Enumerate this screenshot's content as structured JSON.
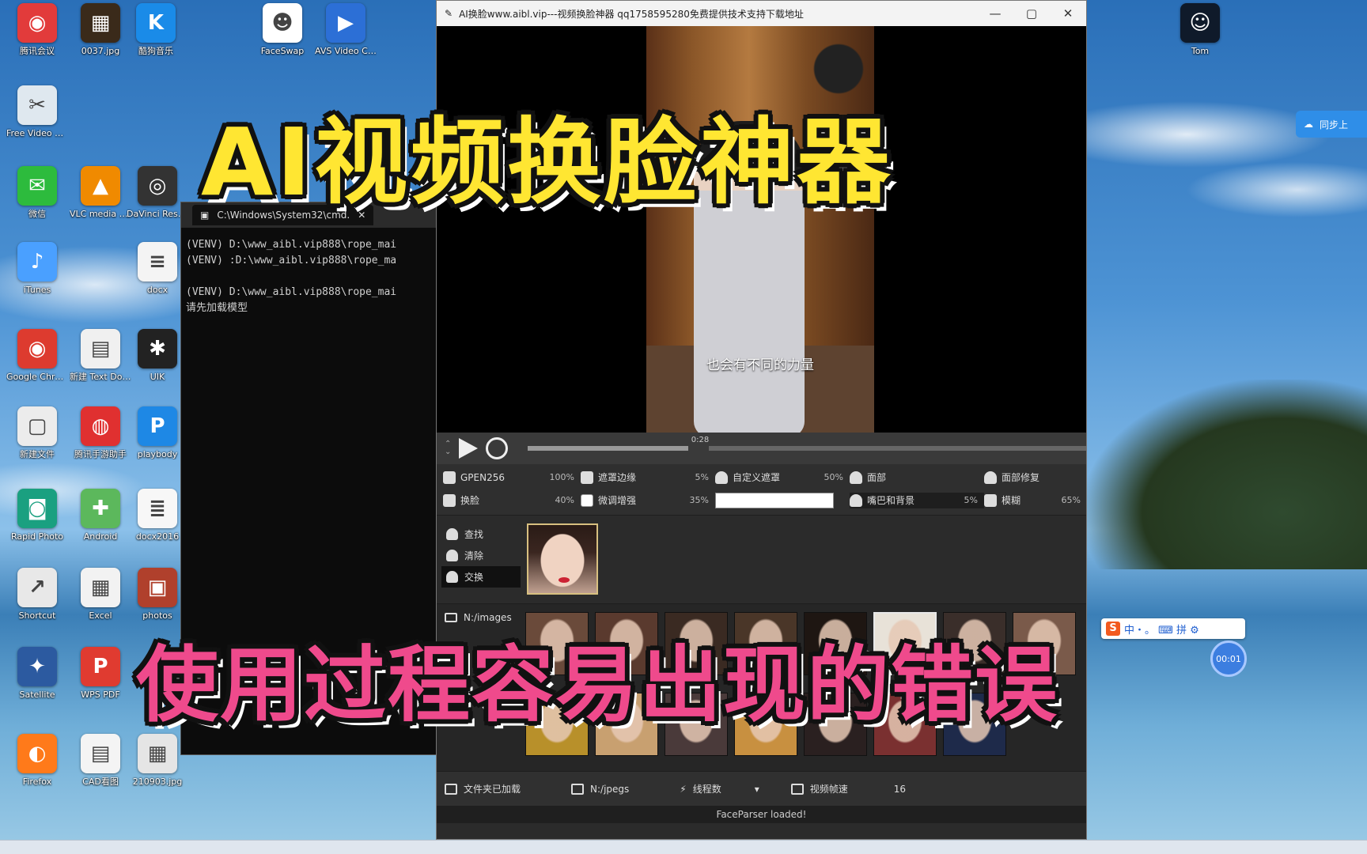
{
  "overlay": {
    "title": "AI视频换脸神器",
    "subtitle": "使用过程容易出现的错误"
  },
  "desktop_icons": [
    {
      "label": "腾讯会议",
      "icon": "meeting-icon",
      "color": "#e23b3b",
      "glyph": "◉"
    },
    {
      "label": "0037.jpg",
      "icon": "image-file-icon",
      "color": "#3a2a1a",
      "glyph": "▦"
    },
    {
      "label": "酷狗音乐",
      "icon": "music-app-icon",
      "color": "#1a8be8",
      "glyph": "K"
    },
    {
      "label": "FaceSwap",
      "icon": "faceswap-app-icon",
      "color": "#ffffff",
      "glyph": "☻"
    },
    {
      "label": "AVS Video Converter",
      "icon": "video-converter-icon",
      "color": "#2c6fd6",
      "glyph": "▶"
    },
    {
      "label": "Free Video Cutter Joi...",
      "icon": "video-cutter-icon",
      "color": "#dfe8ef",
      "glyph": "✂"
    },
    {
      "label": "微信",
      "icon": "wechat-icon",
      "color": "#2dbb3d",
      "glyph": "✉"
    },
    {
      "label": "VLC media player",
      "icon": "vlc-icon",
      "color": "#f08a00",
      "glyph": "▲"
    },
    {
      "label": "DaVinci Resolve",
      "icon": "davinci-icon",
      "color": "#333333",
      "glyph": "◎"
    },
    {
      "label": "iTunes",
      "icon": "itunes-icon",
      "color": "#4aa0ff",
      "glyph": "♪"
    },
    {
      "label": "docx",
      "icon": "document-icon",
      "color": "#f4f4f4",
      "glyph": "≡"
    },
    {
      "label": "Google Chrome",
      "icon": "chrome-icon",
      "color": "#dd3b2f",
      "glyph": "◉"
    },
    {
      "label": "新建 Text Document...",
      "icon": "text-file-icon",
      "color": "#f0f0f0",
      "glyph": "▤"
    },
    {
      "label": "UIK",
      "icon": "uik-app-icon",
      "color": "#222222",
      "glyph": "✱"
    },
    {
      "label": "新建文件",
      "icon": "blank-file-icon",
      "color": "#ececec",
      "glyph": "▢"
    },
    {
      "label": "腾讯手游助手",
      "icon": "game-assistant-icon",
      "color": "#e03030",
      "glyph": "◍"
    },
    {
      "label": "playbody",
      "icon": "playbody-icon",
      "color": "#1e88e5",
      "glyph": "P"
    },
    {
      "label": "Rapid Photo",
      "icon": "photo-app-icon",
      "color": "#1aa080",
      "glyph": "◙"
    },
    {
      "label": "Android",
      "icon": "android-icon",
      "color": "#5cb85c",
      "glyph": "✚"
    },
    {
      "label": "docx2016",
      "icon": "doc-thumb-icon",
      "color": "#f7f7f7",
      "glyph": "≣"
    },
    {
      "label": "Shortcut",
      "icon": "shortcut-icon",
      "color": "#e8e8e8",
      "glyph": "↗"
    },
    {
      "label": "Excel",
      "icon": "spreadsheet-icon",
      "color": "#f2f2f2",
      "glyph": "▦"
    },
    {
      "label": "photos",
      "icon": "photos-icon",
      "color": "#b0402c",
      "glyph": "▣"
    },
    {
      "label": "Satellite",
      "icon": "satellite-icon",
      "color": "#2c5aa0",
      "glyph": "✦"
    },
    {
      "label": "WPS PDF",
      "icon": "wps-pdf-icon",
      "color": "#e03b30",
      "glyph": "P"
    },
    {
      "label": "Firefox",
      "icon": "firefox-icon",
      "color": "#ff7a1a",
      "glyph": "◐"
    },
    {
      "label": "CAD看图",
      "icon": "cad-viewer-icon",
      "color": "#f4f4f4",
      "glyph": "▤"
    },
    {
      "label": "210903.jpg",
      "icon": "jpg-file-icon",
      "color": "#e5e5e5",
      "glyph": "▦"
    },
    {
      "label": "Tom",
      "icon": "tomcat-icon",
      "color": "#0f1a2a",
      "glyph": "☺"
    }
  ],
  "console": {
    "title": "C:\\Windows\\System32\\cmd.",
    "lines": [
      "(VENV) D:\\www_aibl.vip888\\rope_mai",
      "(VENV) :D:\\www_aibl.vip888\\rope_ma",
      "",
      "(VENV) D:\\www_aibl.vip888\\rope_mai",
      "请先加载模型"
    ]
  },
  "app": {
    "title": "AI换脸www.aibl.vip---视频换脸神器  qq1758595280免费提供技术支持下载地址",
    "video_subtitle": "也会有不同的力量",
    "time": "0:28",
    "progress": 0.29,
    "params": [
      {
        "icon": "gpu-icon",
        "label": "GPEN256",
        "value": "100%"
      },
      {
        "icon": "mask-icon",
        "label": "遮罩边缘",
        "value": "5%"
      },
      {
        "icon": "person-icon",
        "label": "自定义遮罩",
        "value": "50%"
      },
      {
        "icon": "person-icon",
        "label": "面部",
        "value": ""
      },
      {
        "icon": "person-icon",
        "label": "面部修复",
        "value": ""
      },
      {
        "icon": "swap-icon",
        "label": "换脸",
        "value": "40%"
      },
      {
        "icon": "checkbox-icon",
        "label": "微调增强",
        "value": "35%"
      },
      {
        "icon": "textbox-icon",
        "label": "",
        "value": ""
      },
      {
        "icon": "person-icon",
        "label": "嘴巴和背景",
        "value": "5%"
      },
      {
        "icon": "slider-icon",
        "label": "模糊",
        "value": "65%"
      }
    ],
    "side_buttons": [
      "查找",
      "清除",
      "交换"
    ],
    "faces_folder": "N:/images",
    "bottom": {
      "video_folder": "文件夹已加载",
      "output_folder": "N:/jpegs",
      "threads_label": "线程数",
      "threads_value": "",
      "frame_label": "视频帧速",
      "frame_value": "16"
    },
    "status": "FaceParser loaded!"
  },
  "cloud_button": "同步上",
  "ime_bar": "中・。 ⌨ 拼 ⚙",
  "float_ball": "00:01",
  "taskbar_time": ""
}
